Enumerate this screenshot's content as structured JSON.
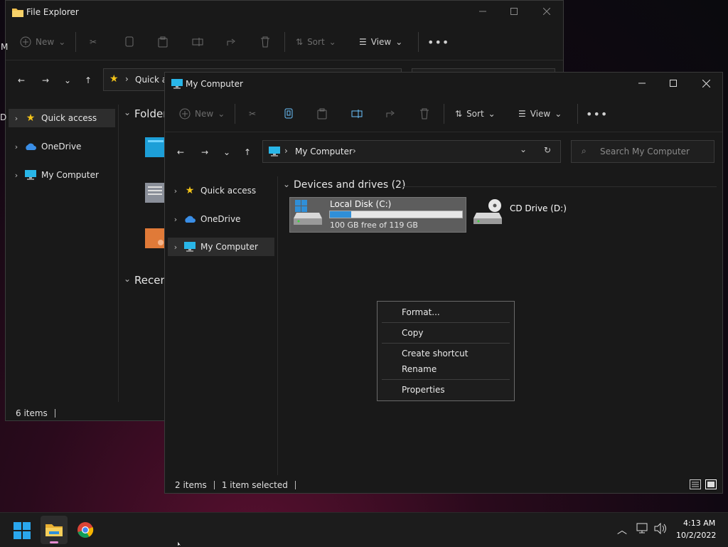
{
  "back_window": {
    "title": "File Explorer",
    "toolbar": {
      "new_label": "New",
      "sort_label": "Sort",
      "view_label": "View"
    },
    "address_text": "Quick a",
    "nav": [
      {
        "label": "Quick access"
      },
      {
        "label": "OneDrive"
      },
      {
        "label": "My Computer"
      }
    ],
    "folders_heading": "Folder",
    "recent_heading": "Recen",
    "status_items": "6 items",
    "left_edge_letters": [
      "D",
      "M"
    ]
  },
  "front_window": {
    "title": "My Computer",
    "toolbar": {
      "new_label": "New",
      "sort_label": "Sort",
      "view_label": "View"
    },
    "breadcrumb": "My Computer",
    "search_placeholder": "Search My Computer",
    "nav": [
      {
        "label": "Quick access"
      },
      {
        "label": "OneDrive"
      },
      {
        "label": "My Computer"
      }
    ],
    "group_heading": "Devices and drives (2)",
    "drives": [
      {
        "name": "Local Disk (C:)",
        "free_text": "100 GB free of 119 GB",
        "used_fraction": 0.16
      },
      {
        "name": "CD Drive (D:)"
      }
    ],
    "status_items": "2 items",
    "status_selected": "1 item selected"
  },
  "context_menu": {
    "items": [
      "Format...",
      "Copy",
      "Create shortcut",
      "Rename",
      "Properties"
    ]
  },
  "taskbar": {
    "time": "4:13 AM",
    "date": "10/2/2022"
  },
  "colors": {
    "accent": "#2f8fd8",
    "folder_yellow": "#f2c14e",
    "star_yellow": "#f5c518",
    "onedrive_blue": "#3a8ee6"
  }
}
